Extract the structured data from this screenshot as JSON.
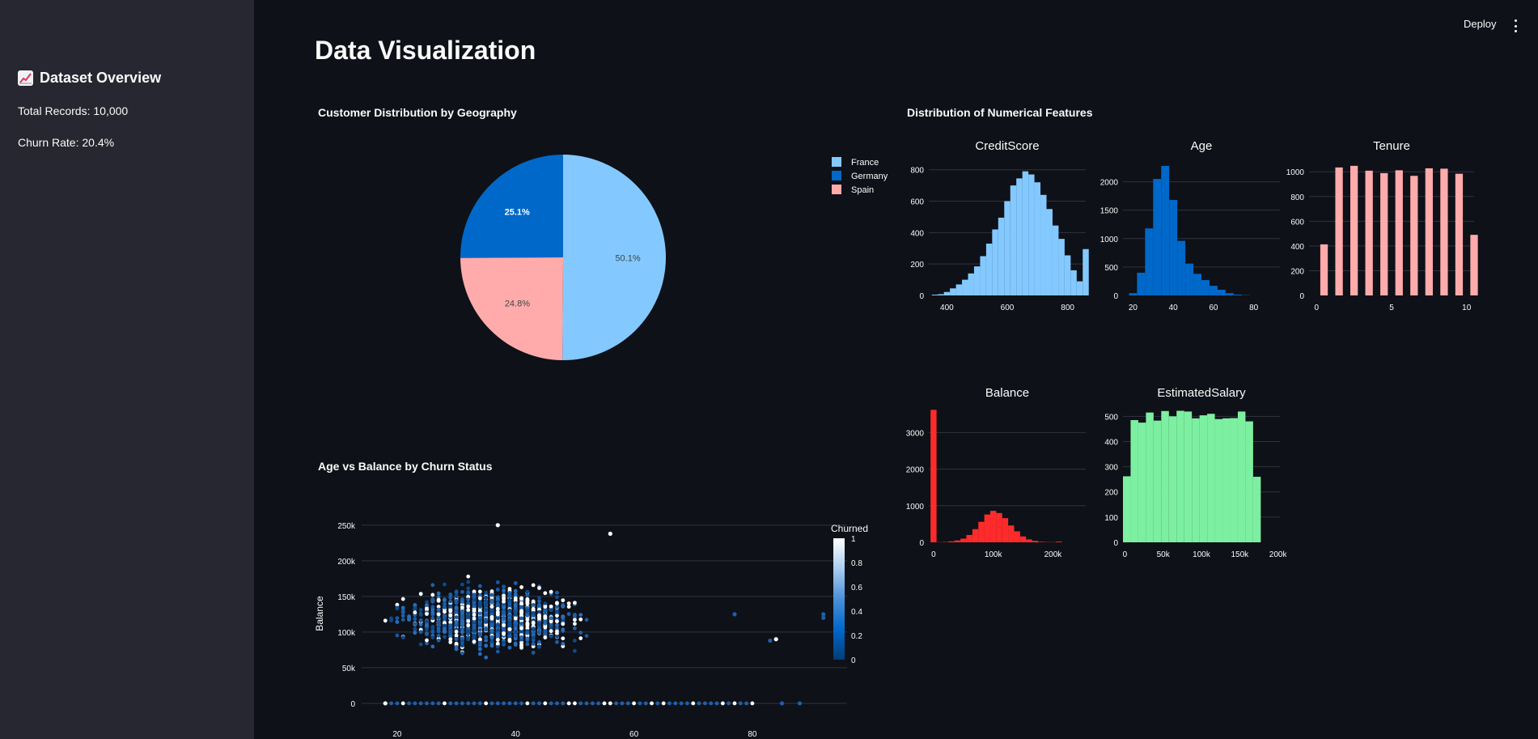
{
  "sidebar": {
    "title": "Dataset Overview",
    "title_icon": "chart-increasing-icon",
    "total_records": "Total Records: 10,000",
    "churn_rate": "Churn Rate: 20.4%"
  },
  "header": {
    "deploy_label": "Deploy",
    "menu_icon": "kebab-menu-icon"
  },
  "page": {
    "title": "Data Visualization",
    "geo_title": "Customer Distribution by Geography",
    "num_title": "Distribution of Numerical Features",
    "scatter_title": "Age vs Balance by Churn Status"
  },
  "colors": {
    "background": "#0e1117",
    "sidebar": "#262730",
    "france": "#83c9ff",
    "germany": "#0068c9",
    "spain": "#ffabab",
    "balance": "#ff2b2b",
    "salary": "#7defa1"
  },
  "chart_data": [
    {
      "id": "geo-pie",
      "type": "pie",
      "title": "Customer Distribution by Geography",
      "labels": [
        "France",
        "Germany",
        "Spain"
      ],
      "values": [
        50.1,
        25.1,
        24.8
      ],
      "text": [
        "50.1%",
        "25.1%",
        "24.8%"
      ],
      "colors": [
        "#83c9ff",
        "#0068c9",
        "#ffabab"
      ],
      "legend": "right"
    },
    {
      "id": "hist-creditscore",
      "type": "bar",
      "title": "CreditScore",
      "x_start": 350,
      "bin_width": 20,
      "values": [
        5,
        8,
        22,
        45,
        70,
        100,
        140,
        185,
        250,
        330,
        420,
        495,
        600,
        700,
        745,
        790,
        770,
        720,
        640,
        550,
        445,
        360,
        255,
        160,
        90,
        295
      ],
      "xticks": [
        400,
        600,
        800
      ],
      "xticklabels": [
        "400",
        "600",
        "800"
      ],
      "yticks": [
        0,
        200,
        400,
        600,
        800
      ],
      "yticklabels": [
        "0",
        "200",
        "400",
        "600",
        "800"
      ],
      "xlim": [
        340,
        860
      ],
      "ylim": [
        0,
        850
      ],
      "color": "#83c9ff"
    },
    {
      "id": "hist-age",
      "type": "bar",
      "title": "Age",
      "x_start": 18,
      "bin_width": 4,
      "values": [
        40,
        400,
        1180,
        2050,
        2280,
        1680,
        960,
        560,
        380,
        270,
        170,
        100,
        40,
        15,
        5
      ],
      "xticks": [
        20,
        40,
        60,
        80
      ],
      "xticklabels": [
        "20",
        "40",
        "60",
        "80"
      ],
      "yticks": [
        0,
        500,
        1000,
        1500,
        2000
      ],
      "yticklabels": [
        "0",
        "500",
        "1000",
        "1500",
        "2000"
      ],
      "xlim": [
        15,
        93
      ],
      "ylim": [
        0,
        2350
      ],
      "color": "#0068c9"
    },
    {
      "id": "hist-tenure",
      "type": "bar",
      "title": "Tenure",
      "x_start": 0,
      "bin_width": 1,
      "values": [
        413,
        1035,
        1048,
        1009,
        989,
        1012,
        967,
        1028,
        1025,
        984,
        490
      ],
      "xticks": [
        0,
        5,
        10
      ],
      "xticklabels": [
        "0",
        "5",
        "10"
      ],
      "yticks": [
        0,
        200,
        400,
        600,
        800,
        1000
      ],
      "yticklabels": [
        "0",
        "200",
        "400",
        "600",
        "800",
        "1000"
      ],
      "xlim": [
        -0.5,
        10.5
      ],
      "ylim": [
        0,
        1080
      ],
      "color": "#ffabab",
      "bar_gap": true
    },
    {
      "id": "hist-balance",
      "type": "bar",
      "title": "Balance",
      "x_start": -5000,
      "bin_width": 10000,
      "values": [
        3620,
        5,
        10,
        25,
        50,
        100,
        200,
        360,
        560,
        760,
        860,
        800,
        660,
        460,
        300,
        160,
        80,
        40,
        15,
        8,
        5,
        20
      ],
      "xticks": [
        0,
        100000,
        200000
      ],
      "xticklabels": [
        "0",
        "100k",
        "200k"
      ],
      "yticks": [
        0,
        1000,
        2000,
        3000
      ],
      "yticklabels": [
        "0",
        "1000",
        "2000",
        "3000"
      ],
      "xlim": [
        -8000,
        255000
      ],
      "ylim": [
        0,
        3650
      ],
      "color": "#ff2b2b"
    },
    {
      "id": "hist-salary",
      "type": "bar",
      "title": "EstimatedSalary",
      "x_start": -2500,
      "bin_width": 10000,
      "values": [
        262,
        485,
        475,
        515,
        483,
        521,
        500,
        522,
        519,
        492,
        504,
        510,
        489,
        492,
        493,
        519,
        480,
        260
      ],
      "xticks": [
        0,
        50000,
        100000,
        150000,
        200000
      ],
      "xticklabels": [
        "0",
        "50k",
        "100k",
        "150k",
        "200k"
      ],
      "yticks": [
        0,
        100,
        200,
        300,
        400,
        500
      ],
      "yticklabels": [
        "0",
        "100",
        "200",
        "300",
        "400",
        "500"
      ],
      "xlim": [
        -2500,
        202500
      ],
      "ylim": [
        0,
        530
      ],
      "color": "#7defa1"
    },
    {
      "id": "scatter-age-balance",
      "type": "scatter",
      "title": "Age vs Balance by Churn Status",
      "xlabel": "",
      "ylabel": "Balance",
      "xlim": [
        14,
        96
      ],
      "ylim": [
        -8000,
        260000
      ],
      "xticks": [
        20,
        40,
        60,
        80
      ],
      "xticklabels": [
        "20",
        "40",
        "60",
        "80"
      ],
      "yticks": [
        0,
        50000,
        100000,
        150000,
        200000,
        250000
      ],
      "yticklabels": [
        "0",
        "50k",
        "100k",
        "150k",
        "200k",
        "250k"
      ],
      "colorbar": {
        "title": "Churned",
        "ticks": [
          0,
          0.2,
          0.4,
          0.6,
          0.8,
          1
        ],
        "ticklabels": [
          "0",
          "0.2",
          "0.4",
          "0.6",
          "0.8",
          "1"
        ],
        "colors": [
          "#003d7a",
          "#0068c9",
          "#4a90d9",
          "#a9cdf0",
          "#ffffff"
        ]
      },
      "outliers": [
        {
          "x": 37,
          "y": 250000,
          "c": 1
        },
        {
          "x": 56,
          "y": 238000,
          "c": 1
        },
        {
          "x": 92,
          "y": 125000,
          "c": 0
        },
        {
          "x": 92,
          "y": 120000,
          "c": 0
        },
        {
          "x": 84,
          "y": 90000,
          "c": 1
        },
        {
          "x": 83,
          "y": 88000,
          "c": 0
        },
        {
          "x": 77,
          "y": 125000,
          "c": 0
        },
        {
          "x": 85,
          "y": 0,
          "c": 0
        },
        {
          "x": 88,
          "y": 0,
          "c": 0
        },
        {
          "x": 18,
          "y": 0,
          "c": 1
        }
      ]
    }
  ]
}
